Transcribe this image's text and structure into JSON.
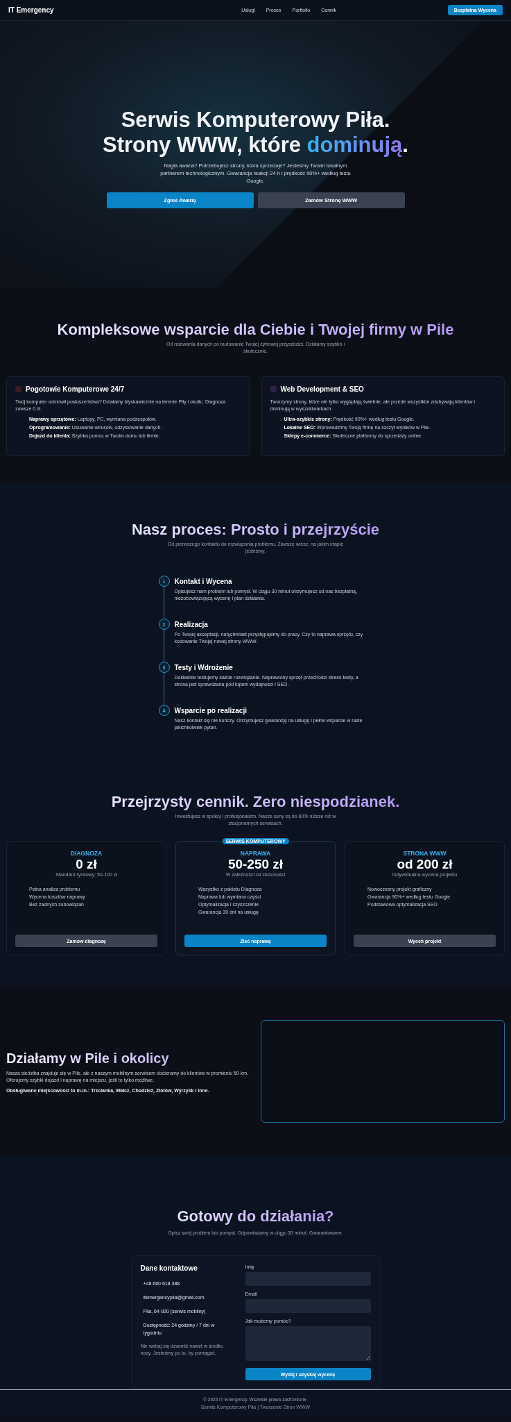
{
  "header": {
    "logo": "IT Emergency",
    "nav": [
      {
        "label": "Usługi"
      },
      {
        "label": "Proces"
      },
      {
        "label": "Portfolio"
      },
      {
        "label": "Cennik"
      }
    ],
    "cta": "Bezpłatna Wycena"
  },
  "hero": {
    "title_parts": [
      {
        "text": "Serwis Komputerowy Piła. Strony WWW, które ",
        "highlight": false
      },
      {
        "text": "dominują",
        "highlight": true
      },
      {
        "text": ".",
        "highlight": false
      }
    ],
    "text": "Nagła awaria? Potrzebujesz strony, która sprzedaje? Jesteśmy Twoim lokalnym partnerem technologicznym. Gwarancja reakcji 24 h i prędkość 90%+ według testu Google.",
    "buttons": [
      {
        "label": "Zgłoś Awarię"
      },
      {
        "label": "Zamów Stronę WWW"
      }
    ]
  },
  "services": {
    "title": "Kompleksowe wsparcie dla Ciebie i Twojej firmy w Pile",
    "subtitle": "Od ratowania danych po budowanie Twojej cyfrowej przyszłości. Działamy szybko i skutecznie.",
    "cards": [
      {
        "title": "Pogotowie Komputerowe 24/7",
        "color": "#3a1a24",
        "text": "Twój komputer odmówił posłuszeństwa? Działamy błyskawicznie na terenie Piły i okolic. Diagnoza zawsze 0 zł.",
        "features": [
          {
            "label": "Naprawy sprzętowe:",
            "text": "Laptopy, PC, wymiana podzespołów."
          },
          {
            "label": "Oprogramowanie:",
            "text": "Usuwanie wirusów, odzyskiwanie danych."
          },
          {
            "label": "Dojazd do klienta:",
            "text": "Szybka pomoc w Twoim domu lub firmie."
          }
        ]
      },
      {
        "title": "Web Development & SEO",
        "color": "#2e2248",
        "text": "Tworzymy strony, które nie tylko wyglądają świetnie, ale przede wszystkim zdobywają klientów i dominują w wyszukiwarkach.",
        "features": [
          {
            "label": "Ultra-szybkie strony:",
            "text": "Prędkość 90%+ według testu Google."
          },
          {
            "label": "Lokalne SEO:",
            "text": "Wprowadzimy Twoją firmę na szczyt wyników w Pile."
          },
          {
            "label": "Sklepy e-commerce:",
            "text": "Skuteczne platformy do sprzedaży online."
          }
        ]
      }
    ]
  },
  "process": {
    "title": "Nasz proces: Prosto i przejrzyście",
    "subtitle": "Od pierwszego kontaktu do rozwiązania problemu. Zawsze wiesz, na jakim etapie jesteśmy.",
    "steps": [
      {
        "number": "1",
        "title": "Kontakt i Wycena",
        "text": "Opisujesz nam problem lub pomysł. W ciągu 30 minut otrzymujesz od nas bezpłatną, niezobowiązującą wycenę i plan działania."
      },
      {
        "number": "2",
        "title": "Realizacja",
        "text": "Po Twojej akceptacji, natychmiast przystępujemy do pracy. Czy to naprawa sprzętu, czy kodowanie Twojej nowej strony WWW."
      },
      {
        "number": "3",
        "title": "Testy i Wdrożenie",
        "text": "Dokładnie testujemy każde rozwiązanie. Naprawiony sprzęt przechodzi stress-testy, a strona jest sprawdzana pod kątem wydajności i SEO."
      },
      {
        "number": "4",
        "title": "Wsparcie po realizacji",
        "text": "Nasz kontakt się nie kończy. Otrzymujesz gwarancję na usługę i pełne wsparcie w razie jakichkolwiek pytań."
      }
    ]
  },
  "pricing": {
    "title": "Przejrzysty cennik. Zero niespodzianek.",
    "subtitle": "Inwestujesz w spokój i profesjonalizm. Nasze ceny są do 60% niższe niż w stacjonarnych serwisach.",
    "plans": [
      {
        "name": "DIAGNOZA",
        "price": "0 zł",
        "note": "Standard rynkowy: 50-100 zł",
        "features": [
          "Pełna analiza problemu",
          "Wycena kosztów naprawy",
          "Bez żadnych zobowiązań"
        ],
        "button": "Zamów diagnozę",
        "featured": false
      },
      {
        "badge": "SERWIS KOMPUTEROWY",
        "name": "NAPRAWA",
        "price": "50-250 zł",
        "note": "W zależności od złożoności",
        "features": [
          "Wszystko z pakietu Diagnoza",
          "Naprawa lub wymiana części",
          "Optymalizacja i czyszczenie",
          "Gwarancja 30 dni na usługę"
        ],
        "button": "Zleć naprawę",
        "featured": true
      },
      {
        "name": "STRONA WWW",
        "price": "od 200 zł",
        "note": "Indywidualna wycena projektu",
        "features": [
          "Nowoczesny projekt graficzny",
          "Gwarancja 90%+ według testu Google",
          "Podstawowa optymalizacja SEO"
        ],
        "button": "Wyceń projekt",
        "featured": false
      }
    ]
  },
  "location": {
    "title": "Działamy w Pile i okolicy",
    "text": "Nasza siedziba znajduje się w Pile, ale z naszym mobilnym serwisem docieramy do klientów w promieniu 50 km. Oferujemy szybki dojazd i naprawę na miejscu, jeśli to tylko możliwe.",
    "towns": "Obsługiwane miejscowości to m.in.: Trzcianka, Wałcz, Chodzież, Złotów, Wyrzysk i inne."
  },
  "contact": {
    "title": "Gotowy do działania?",
    "subtitle": "Opisz swój problem lub pomysł. Odpowiadamy w ciągu 30 minut. Gwarantowane.",
    "info_title": "Dane kontaktowe",
    "info": [
      "+48 660 618 388",
      "itemergencypila@gmail.com",
      "Piła, 64-920 (serwis mobilny)",
      "Dostępność: 24 godziny / 7 dni w tygodniu"
    ],
    "note": "Nie wahaj się dzwonić nawet w środku nocy. Jesteśmy po to, by pomagać.",
    "fields": [
      {
        "label": "Imię",
        "kind": "text"
      },
      {
        "label": "Email",
        "kind": "text"
      },
      {
        "label": "Jak możemy pomóc?",
        "kind": "textarea"
      }
    ],
    "submit": "Wyślij i uzyskaj wycenę"
  },
  "footer": {
    "copyright": "© 2025 IT Emergency. Wszelkie prawa zastrzeżone.",
    "tagline": "Serwis Komputerowy Piła | Tworzenie Stron WWW"
  }
}
